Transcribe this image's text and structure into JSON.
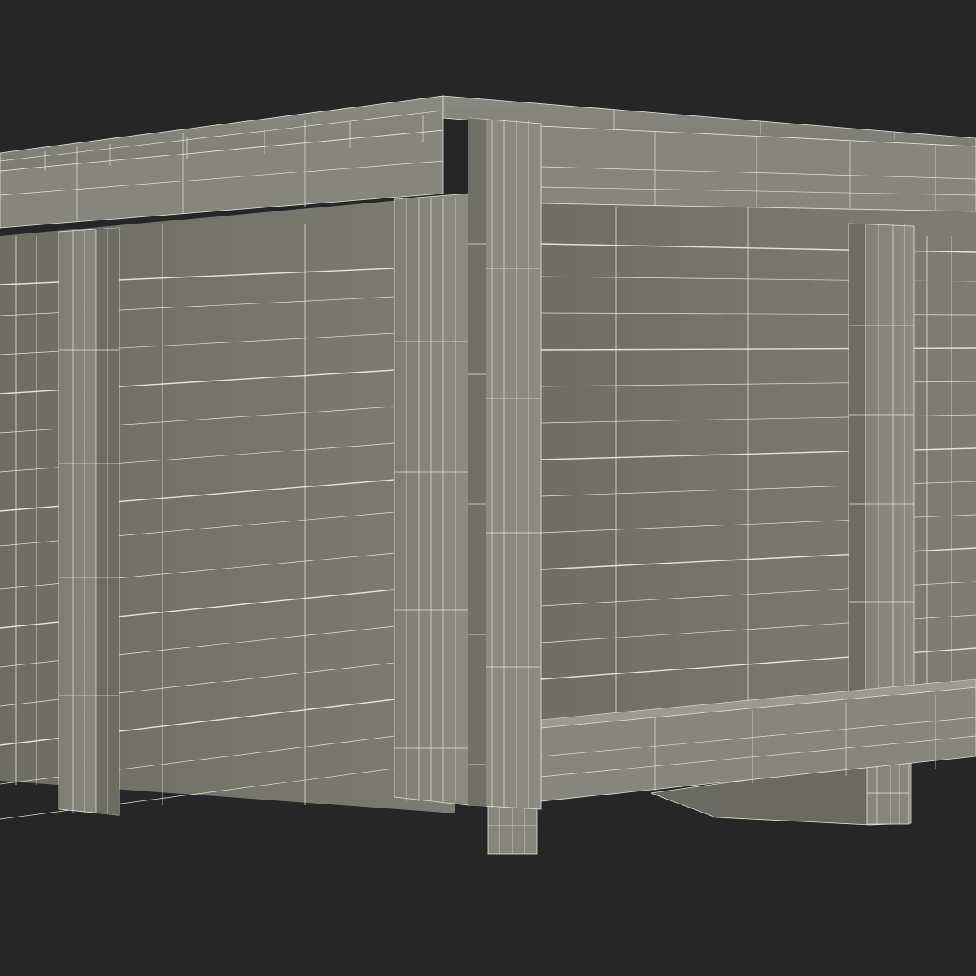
{
  "scene": {
    "subject": "wooden-crate-wireframe-render",
    "colors": {
      "background": "#262626",
      "panel": "#7a7a6e",
      "panel_shade": "#6c6c60",
      "frame": "#84847a",
      "frame_shade": "#6e6e64",
      "top": "#8c8c82",
      "wire": "#e4e4d6",
      "dark_edge": "#3a3a34"
    }
  }
}
